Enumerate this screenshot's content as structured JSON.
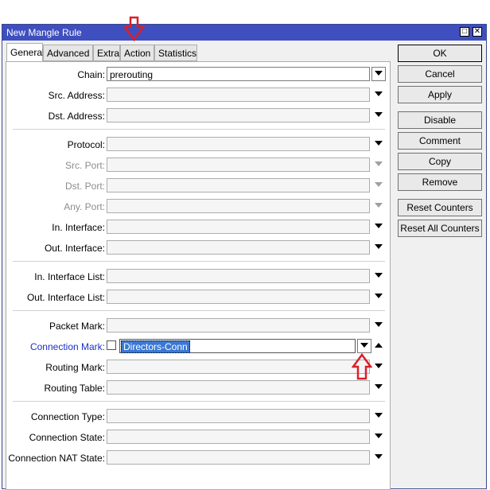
{
  "window": {
    "title": "New Mangle Rule",
    "controls": [
      "□",
      "✕"
    ]
  },
  "tabs": [
    "General",
    "Advanced",
    "Extra",
    "Action",
    "Statistics"
  ],
  "fields": {
    "chain": {
      "label": "Chain:",
      "value": "prerouting"
    },
    "src_address": "Src. Address:",
    "dst_address": "Dst. Address:",
    "protocol": "Protocol:",
    "src_port": "Src. Port:",
    "dst_port": "Dst. Port:",
    "any_port": "Any. Port:",
    "in_interface": "In. Interface:",
    "out_interface": "Out. Interface:",
    "in_interface_list": "In. Interface List:",
    "out_interface_list": "Out. Interface List:",
    "packet_mark": "Packet Mark:",
    "connection_mark": {
      "label": "Connection Mark:",
      "value": "Directors-Conn"
    },
    "routing_mark": "Routing Mark:",
    "routing_table": "Routing Table:",
    "connection_type": "Connection Type:",
    "connection_state": "Connection State:",
    "connection_nat_state": "Connection NAT State:"
  },
  "buttons": {
    "ok": "OK",
    "cancel": "Cancel",
    "apply": "Apply",
    "disable": "Disable",
    "comment": "Comment",
    "copy": "Copy",
    "remove": "Remove",
    "reset_counters": "Reset Counters",
    "reset_all_counters": "Reset All Counters"
  },
  "colors": {
    "titlebar": "#3f4fbf",
    "highlight_label": "#1c2fc9",
    "selection": "#3a78d6",
    "annotation_arrow": "#d9202a"
  },
  "icons": {
    "dropdown": "triangle-down-icon",
    "collapse": "triangle-up-icon",
    "annotation": "red-outline-arrow-icon"
  }
}
